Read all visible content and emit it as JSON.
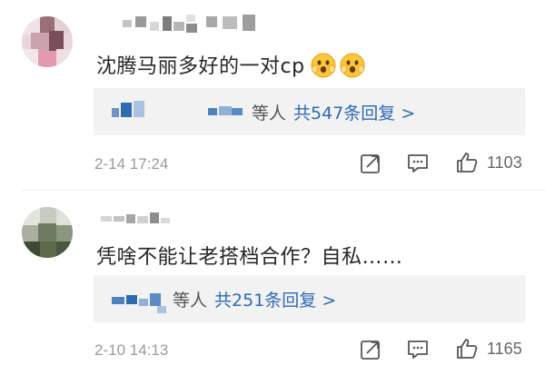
{
  "comments": [
    {
      "text": "沈腾马丽多好的一对cp",
      "reply_names_suffix": "等人",
      "reply_link": "共547条回复 >",
      "time": "2-14 17:24",
      "likes": "1103"
    },
    {
      "text": "凭啥不能让老搭档合作？自私……",
      "reply_names_suffix": "等人",
      "reply_link": "共251条回复 >",
      "time": "2-10 14:13",
      "likes": "1165"
    }
  ],
  "icons": {
    "emoji": "scared-face-emoji",
    "share": "share-icon",
    "comment": "comment-icon",
    "like": "thumbs-up-icon"
  },
  "colors": {
    "link": "#2f6bb0",
    "text": "#262626",
    "meta": "#9a9a9a",
    "reply_bg": "#f2f2f2",
    "emoji": "#ffc63a"
  }
}
